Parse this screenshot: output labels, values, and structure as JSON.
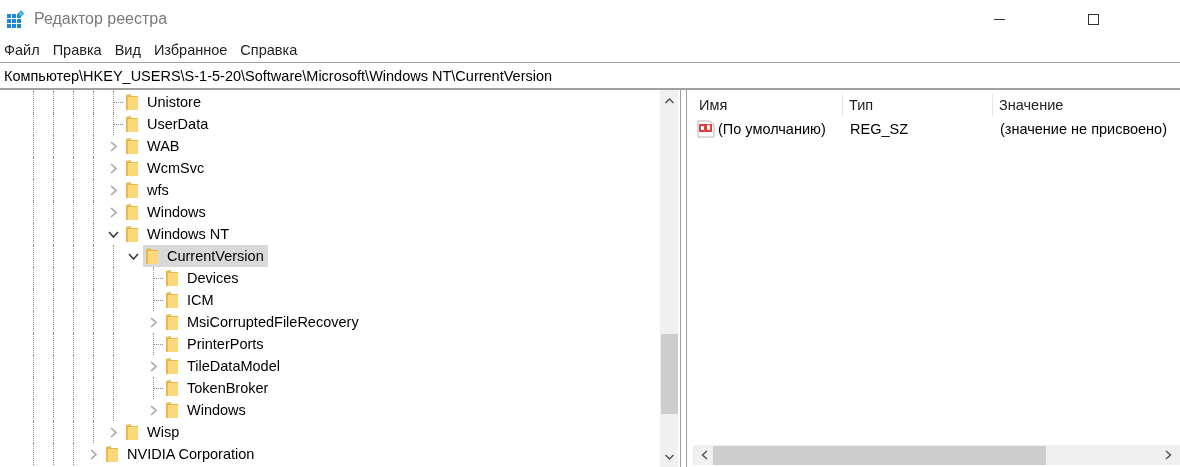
{
  "window": {
    "title": "Редактор реестра"
  },
  "menu": [
    "Файл",
    "Правка",
    "Вид",
    "Избранное",
    "Справка"
  ],
  "address": "Компьютер\\HKEY_USERS\\S-1-5-20\\Software\\Microsoft\\Windows NT\\CurrentVersion",
  "tree": [
    {
      "children": [
        {
          "label": "Unistore",
          "kind": "leaf",
          "selected": false
        },
        {
          "label": "UserData",
          "kind": "leaf",
          "selected": false
        },
        {
          "label": "WAB",
          "kind": "collapsed",
          "selected": false
        },
        {
          "label": "WcmSvc",
          "kind": "collapsed",
          "selected": false
        },
        {
          "label": "wfs",
          "kind": "collapsed",
          "selected": false
        },
        {
          "label": "Windows",
          "kind": "collapsed",
          "selected": false
        },
        {
          "label": "Windows NT",
          "kind": "expanded",
          "selected": false,
          "children": [
            {
              "label": "CurrentVersion",
              "kind": "expanded",
              "selected": true,
              "children": [
                {
                  "label": "Devices",
                  "kind": "leaf",
                  "selected": false
                },
                {
                  "label": "ICM",
                  "kind": "leaf",
                  "selected": false
                },
                {
                  "label": "MsiCorruptedFileRecovery",
                  "kind": "collapsed",
                  "selected": false
                },
                {
                  "label": "PrinterPorts",
                  "kind": "leaf",
                  "selected": false
                },
                {
                  "label": "TileDataModel",
                  "kind": "collapsed",
                  "selected": false
                },
                {
                  "label": "TokenBroker",
                  "kind": "leaf",
                  "selected": false
                },
                {
                  "label": "Windows",
                  "kind": "collapsed",
                  "selected": false
                }
              ]
            }
          ]
        },
        {
          "label": "Wisp",
          "kind": "collapsed",
          "selected": false
        }
      ]
    },
    {
      "label": "NVIDIA Corporation",
      "kind": "collapsed",
      "selected": false
    }
  ],
  "values": {
    "columns": [
      "Имя",
      "Тип",
      "Значение"
    ],
    "rows": [
      {
        "name": "(По умолчанию)",
        "type": "REG_SZ",
        "data": "(значение не присвоено)"
      }
    ]
  }
}
